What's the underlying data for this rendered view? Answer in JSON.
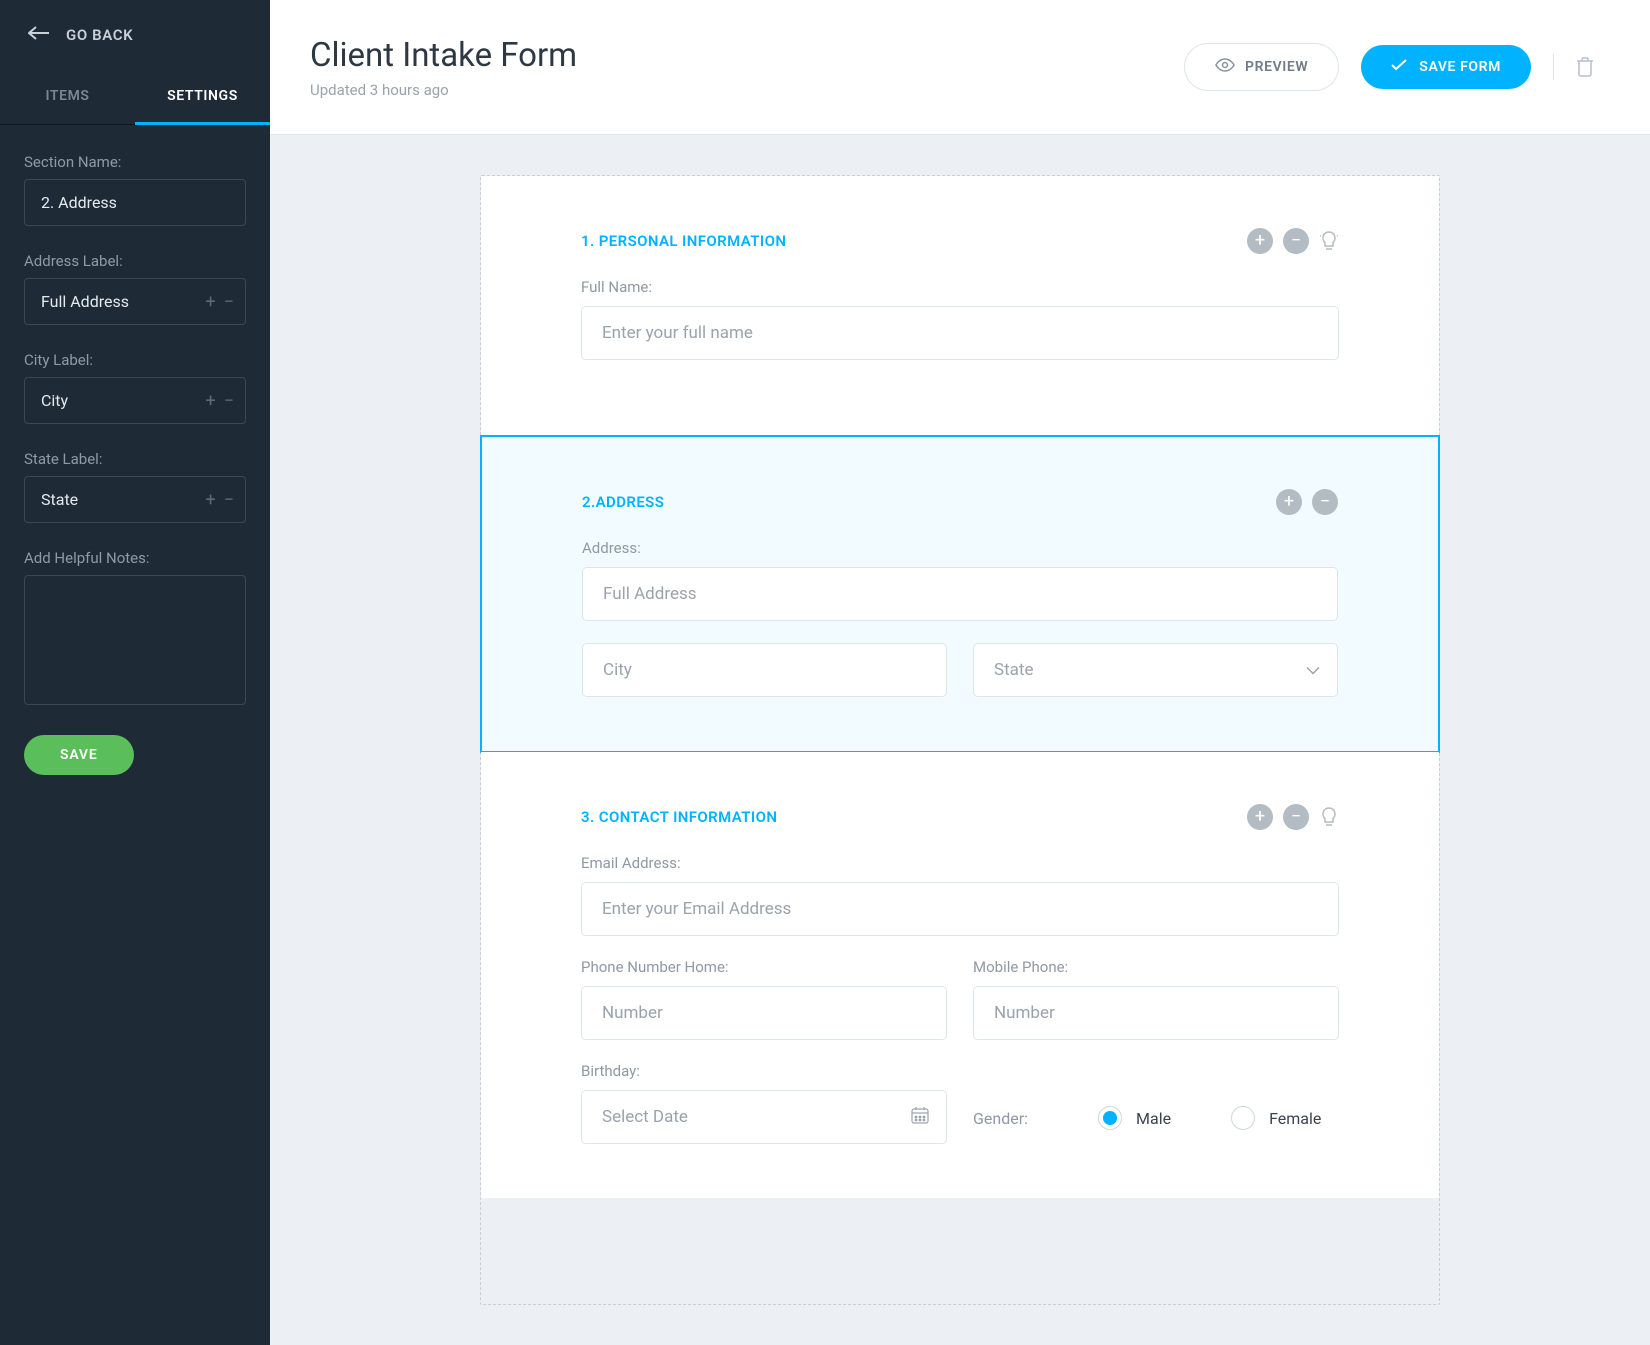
{
  "sidebar": {
    "goback": "GO BACK",
    "tabs": {
      "items": "ITEMS",
      "settings": "SETTINGS"
    },
    "sectionNameLabel": "Section Name:",
    "sectionNameValue": "2. Address",
    "addressLabelLabel": "Address Label:",
    "addressLabelValue": "Full Address",
    "cityLabelLabel": "City Label:",
    "cityLabelValue": "City",
    "stateLabelLabel": "State Label:",
    "stateLabelValue": "State",
    "notesLabel": "Add Helpful Notes:",
    "save": "SAVE"
  },
  "header": {
    "title": "Client Intake Form",
    "subtitle": "Updated 3 hours ago",
    "preview": "PREVIEW",
    "saveForm": "SAVE FORM"
  },
  "sections": {
    "s1": {
      "title": "1. PERSONAL INFORMATION",
      "fullNameLabel": "Full Name:",
      "fullNamePlaceholder": "Enter your full name"
    },
    "s2": {
      "title": "2.ADDRESS",
      "addressLabel": "Address:",
      "addressPlaceholder": "Full Address",
      "cityPlaceholder": "City",
      "statePlaceholder": "State"
    },
    "s3": {
      "title": "3. CONTACT INFORMATION",
      "emailLabel": "Email Address:",
      "emailPlaceholder": "Enter your Email Address",
      "phoneHomeLabel": "Phone Number Home:",
      "mobileLabel": "Mobile Phone:",
      "numberPlaceholder": "Number",
      "birthdayLabel": "Birthday:",
      "birthdayPlaceholder": "Select Date",
      "genderLabel": "Gender:",
      "male": "Male",
      "female": "Female"
    }
  }
}
